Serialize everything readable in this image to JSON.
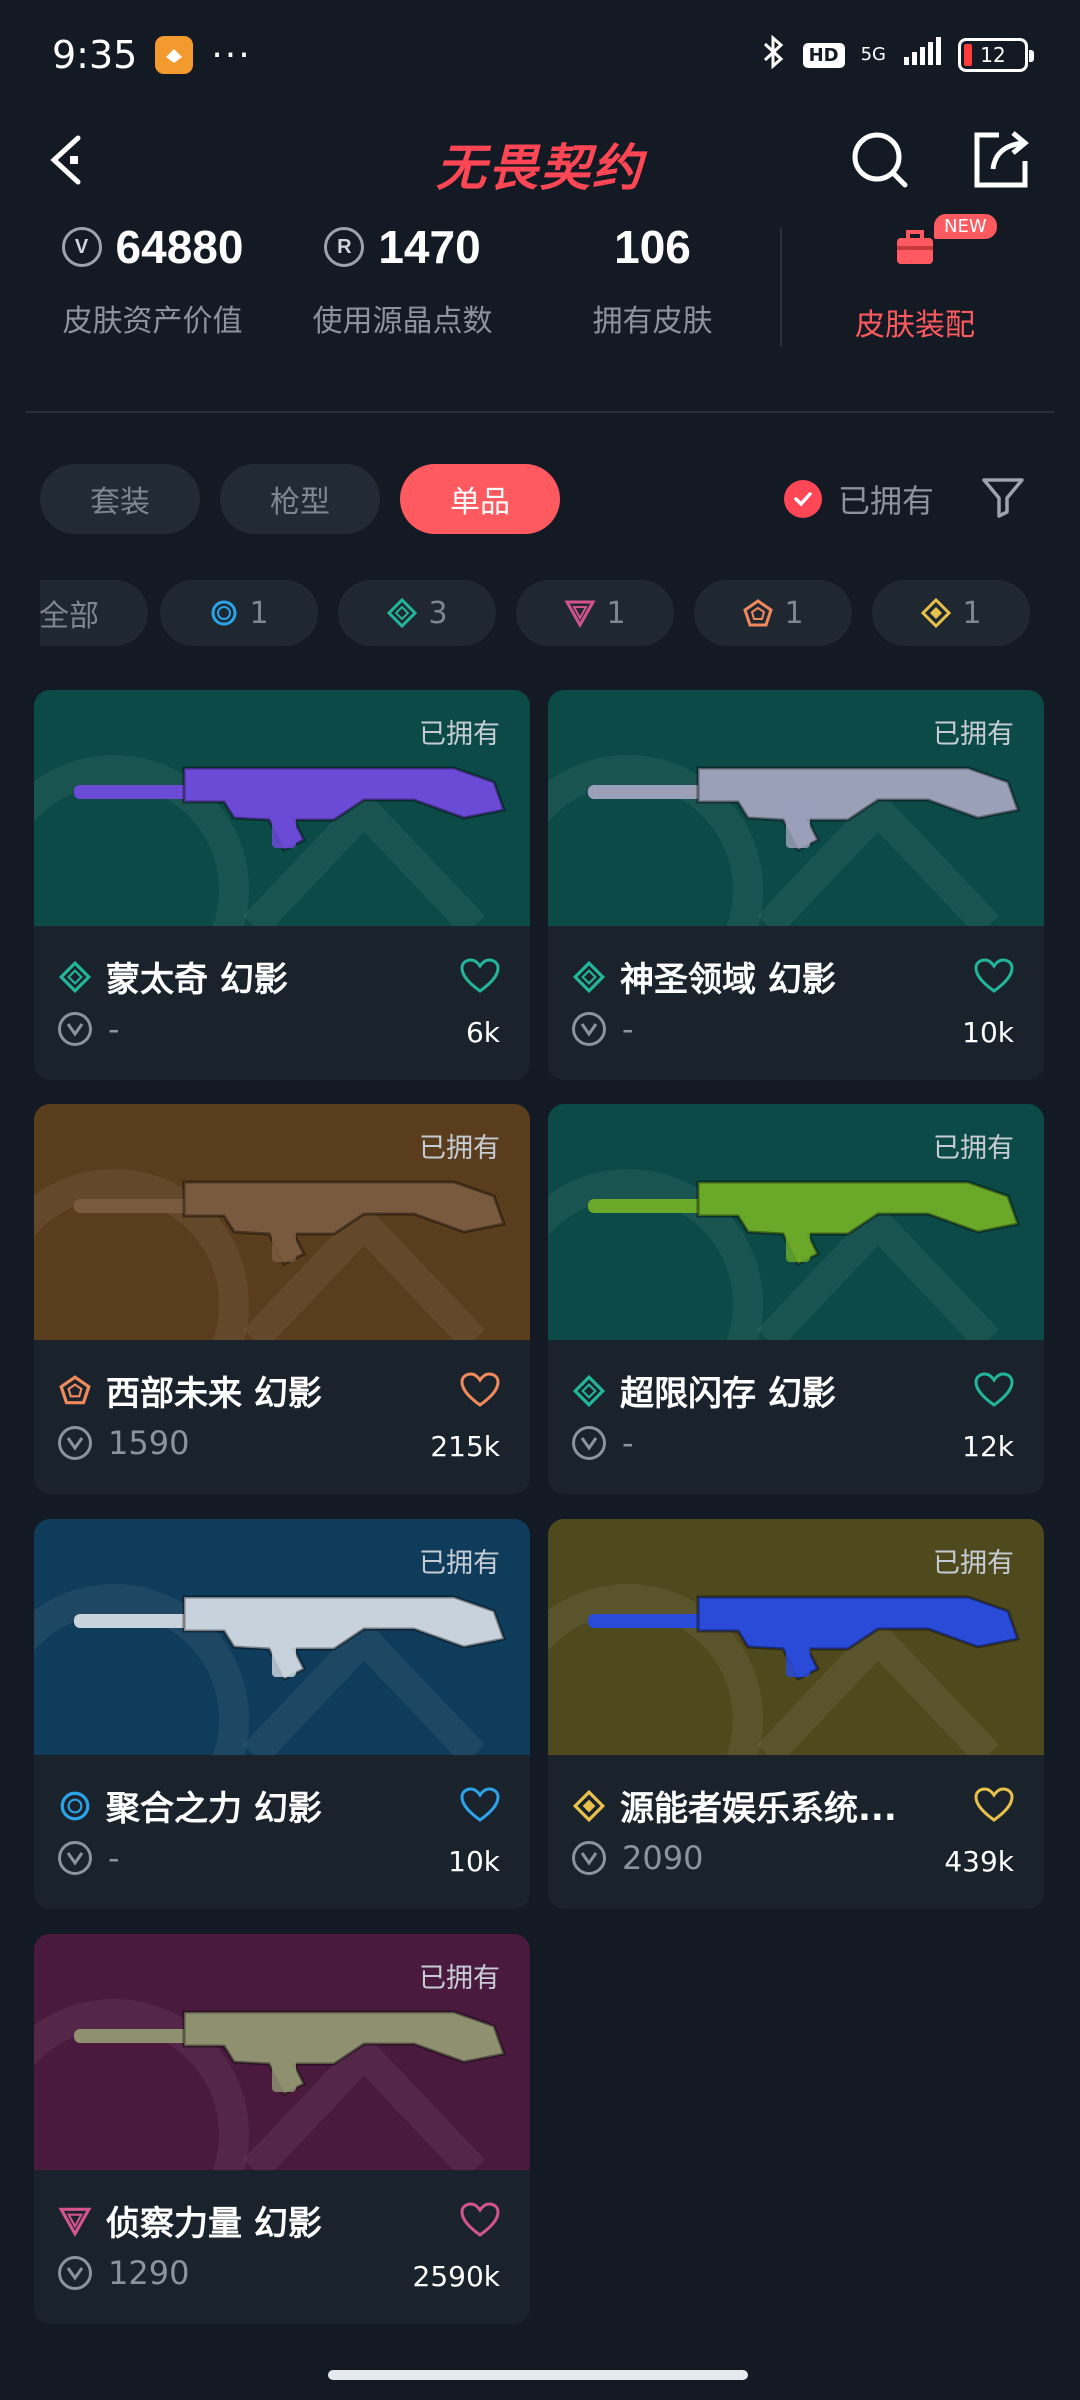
{
  "status_bar": {
    "time": "9:35",
    "dots": "···",
    "hd": "HD",
    "network": "5G",
    "battery": "12"
  },
  "header": {
    "logo": "无畏契约"
  },
  "stats": [
    {
      "value": "64880",
      "label": "皮肤资产价值",
      "icon": "vp-coin-icon"
    },
    {
      "value": "1470",
      "label": "使用源晶点数",
      "icon": "radianite-icon"
    },
    {
      "value": "106",
      "label": "拥有皮肤",
      "icon": ""
    }
  ],
  "equip": {
    "label": "皮肤装配",
    "badge": "NEW"
  },
  "tabs": [
    {
      "label": "套装",
      "active": false
    },
    {
      "label": "枪型",
      "active": false
    },
    {
      "label": "单品",
      "active": true
    }
  ],
  "owned_toggle": {
    "label": "已拥有",
    "checked": true
  },
  "tier_chips": [
    {
      "label": "全部",
      "icon": ""
    },
    {
      "label": "1",
      "icon": "select-tier-icon",
      "color": "#2aa3e8"
    },
    {
      "label": "3",
      "icon": "deluxe-tier-icon",
      "color": "#22b59a"
    },
    {
      "label": "1",
      "icon": "premium-tier-icon",
      "color": "#d1548e"
    },
    {
      "label": "1",
      "icon": "exclusive-tier-icon",
      "color": "#f08a5d"
    },
    {
      "label": "1",
      "icon": "ultra-tier-icon",
      "color": "#e8c14a"
    }
  ],
  "cards": [
    {
      "name": "蒙太奇 幻影",
      "owned": "已拥有",
      "price": "-",
      "likes": "6k",
      "tier_color": "#22b59a",
      "bg": "#0b4a46"
    },
    {
      "name": "神圣领域 幻影",
      "owned": "已拥有",
      "price": "-",
      "likes": "10k",
      "tier_color": "#22b59a",
      "bg": "#0b4a46"
    },
    {
      "name": "西部未来 幻影",
      "owned": "已拥有",
      "price": "1590",
      "likes": "215k",
      "tier_color": "#f08a5d",
      "bg": "#5a3d1c"
    },
    {
      "name": "超限闪存 幻影",
      "owned": "已拥有",
      "price": "-",
      "likes": "12k",
      "tier_color": "#22b59a",
      "bg": "#0b4a46"
    },
    {
      "name": "聚合之力 幻影",
      "owned": "已拥有",
      "price": "-",
      "likes": "10k",
      "tier_color": "#2aa3e8",
      "bg": "#0f3c5a"
    },
    {
      "name": "源能者娱乐系统...",
      "owned": "已拥有",
      "price": "2090",
      "likes": "439k",
      "tier_color": "#e8c14a",
      "bg": "#4f4a1e"
    },
    {
      "name": "侦察力量 幻影",
      "owned": "已拥有",
      "price": "1290",
      "likes": "2590k",
      "tier_color": "#d1548e",
      "bg": "#4a1a3e"
    }
  ]
}
